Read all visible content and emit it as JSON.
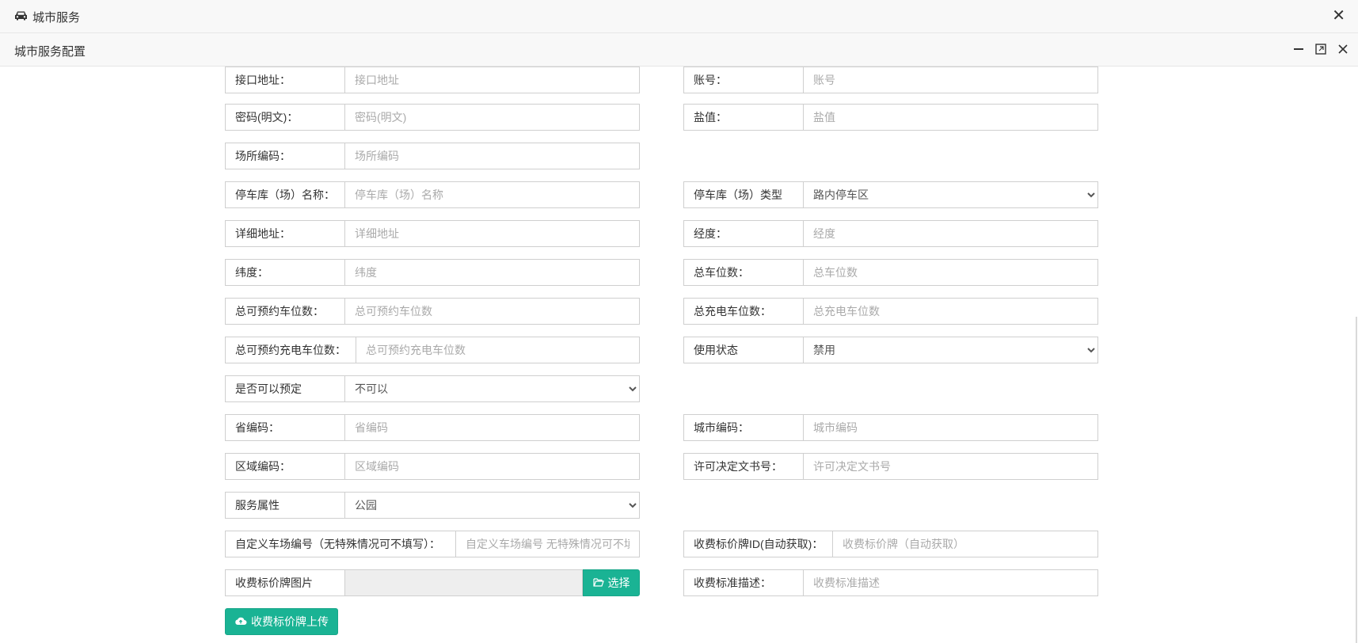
{
  "window": {
    "title": "城市服务",
    "close_glyph": "✕"
  },
  "dialog": {
    "title": "城市服务配置"
  },
  "fields": {
    "api_url": {
      "label": "接口地址：",
      "placeholder": "接口地址"
    },
    "account": {
      "label": "账号：",
      "placeholder": "账号"
    },
    "password": {
      "label": "密码(明文)：",
      "placeholder": "密码(明文)"
    },
    "salt": {
      "label": "盐值：",
      "placeholder": "盐值"
    },
    "site_code": {
      "label": "场所编码：",
      "placeholder": "场所编码"
    },
    "lot_name": {
      "label": "停车库（场）名称：",
      "placeholder": "停车库（场）名称"
    },
    "lot_type": {
      "label": "停车库（场）类型",
      "value": "路内停车区"
    },
    "address": {
      "label": "详细地址：",
      "placeholder": "详细地址"
    },
    "longitude": {
      "label": "经度：",
      "placeholder": "经度"
    },
    "latitude": {
      "label": "纬度：",
      "placeholder": "纬度"
    },
    "total_spaces": {
      "label": "总车位数：",
      "placeholder": "总车位数"
    },
    "reservable_spaces": {
      "label": "总可预约车位数：",
      "placeholder": "总可预约车位数"
    },
    "charging_spaces": {
      "label": "总充电车位数：",
      "placeholder": "总充电车位数"
    },
    "reservable_charging": {
      "label": "总可预约充电车位数：",
      "placeholder": "总可预约充电车位数"
    },
    "status": {
      "label": "使用状态",
      "value": "禁用"
    },
    "bookable": {
      "label": "是否可以预定",
      "value": "不可以"
    },
    "province_code": {
      "label": "省编码：",
      "placeholder": "省编码"
    },
    "city_code": {
      "label": "城市编码：",
      "placeholder": "城市编码"
    },
    "district_code": {
      "label": "区域编码：",
      "placeholder": "区域编码"
    },
    "license_no": {
      "label": "许可决定文书号：",
      "placeholder": "许可决定文书号"
    },
    "service_attr": {
      "label": "服务属性",
      "value": "公园"
    },
    "custom_lot_no": {
      "label": "自定义车场编号（无特殊情况可不填写）：",
      "placeholder": "自定义车场编号 无特殊情况可不填写"
    },
    "price_board_id": {
      "label": "收费标价牌ID(自动获取)：",
      "placeholder": "收费标价牌（自动获取）"
    },
    "price_board_image": {
      "label": "收费标价牌图片",
      "button": "选择"
    },
    "fee_desc": {
      "label": "收费标准描述：",
      "placeholder": "收费标准描述"
    }
  },
  "upload_button": "收费标价牌上传",
  "icons": {
    "car": "car-icon",
    "folder": "folder-open-icon",
    "upload": "cloud-upload-icon"
  },
  "colors": {
    "accent": "#1ab394"
  }
}
